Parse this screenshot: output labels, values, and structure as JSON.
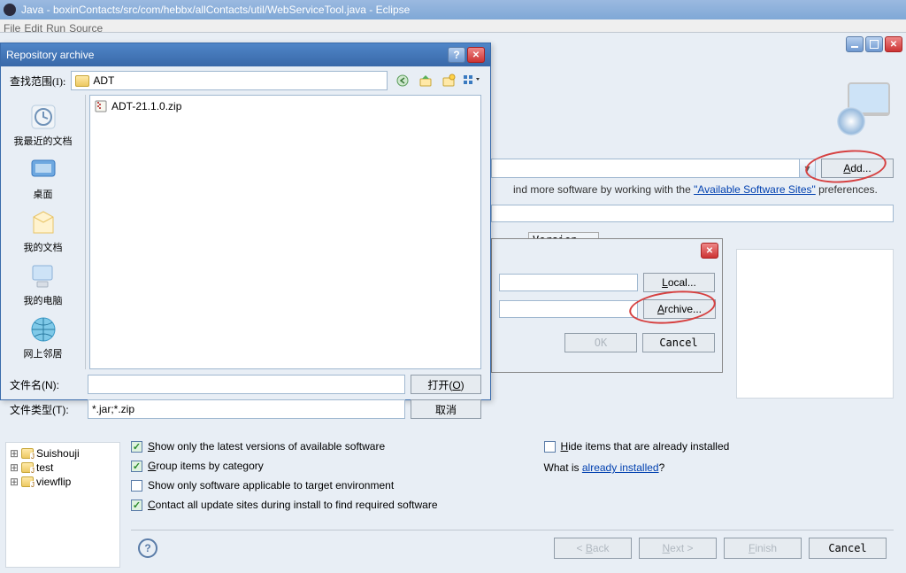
{
  "eclipse_title": "Java - boxinContacts/src/com/hebbx/allContacts/util/WebServiceTool.java - Eclipse",
  "menu": {
    "file": "File",
    "edit": "Edit",
    "run": "Run",
    "source": "Source"
  },
  "workwith": {
    "add_label": "Add..."
  },
  "hint": {
    "prefix": "ind more software by working with the ",
    "link": "\"Available Software Sites\"",
    "suffix": " preferences."
  },
  "version_header": "Version",
  "add_repo": {
    "local": "Local...",
    "archive": "Archive...",
    "ok": "OK",
    "cancel": "Cancel"
  },
  "checkboxes": {
    "show_latest": "Show only the latest versions of available software",
    "group_cat": "Group items by category",
    "target_env": "Show only software applicable to target environment",
    "contact_all": "Contact all update sites during install to find required software",
    "hide_installed": "Hide items that are already installed"
  },
  "whatis": {
    "prefix": "What is ",
    "link": "already installed",
    "suffix": "?"
  },
  "wizard": {
    "back": "< Back",
    "next": "Next >",
    "finish": "Finish",
    "cancel": "Cancel"
  },
  "tree_items": [
    "Suishouji",
    "test",
    "viewflip"
  ],
  "file_dialog": {
    "title": "Repository archive",
    "lookin_label": "查找范围(I):",
    "folder_name": "ADT",
    "file_entry": "ADT-21.1.0.zip",
    "places": {
      "recent": "我最近的文档",
      "desktop": "桌面",
      "mydocs": "我的文档",
      "computer": "我的电脑",
      "network": "网上邻居"
    },
    "filename_label": "文件名(N):",
    "filename_value": "",
    "filetype_label": "文件类型(T):",
    "filetype_value": "*.jar;*.zip",
    "open_btn": "打开(O)",
    "cancel_btn": "取消"
  }
}
